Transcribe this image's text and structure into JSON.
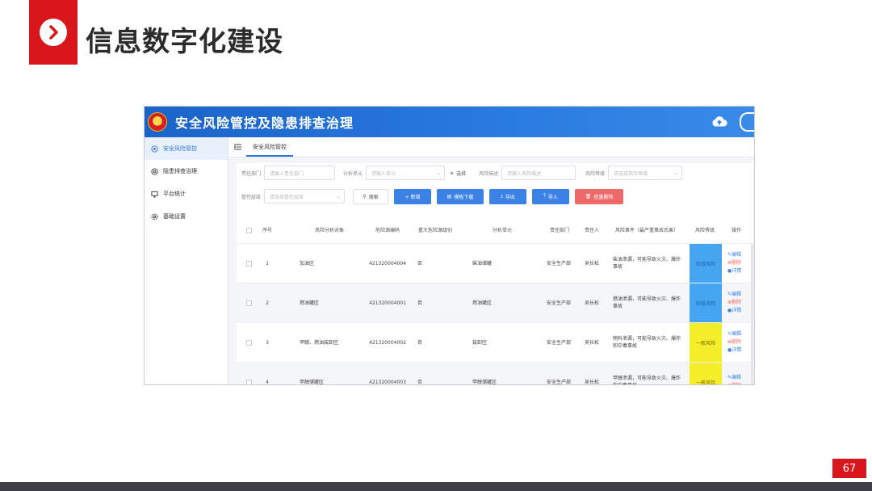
{
  "slide": {
    "title": "信息数字化建设",
    "page_number": "67"
  },
  "app": {
    "title": "安全风险管控及隐患排查治理",
    "sidebar": [
      {
        "label": "安全风险管控",
        "icon": "shield-icon",
        "active": true
      },
      {
        "label": "隐患排查治理",
        "icon": "target-icon",
        "active": false
      },
      {
        "label": "平台统计",
        "icon": "monitor-icon",
        "active": false
      },
      {
        "label": "基础设置",
        "icon": "gear-icon",
        "active": false
      }
    ],
    "tab": "安全风险管控",
    "filters": {
      "dept_label": "责任部门",
      "dept_placeholder": "请输入责任部门",
      "unit_label": "分析单元",
      "unit_placeholder": "请输入单元",
      "select_label": "选择",
      "desc_label": "风险描述",
      "desc_placeholder": "请输入风险描述",
      "level_label": "风险等级",
      "level_placeholder": "请选择风险等级",
      "mgmt_label": "管控层级",
      "mgmt_placeholder": "请选择管控层级"
    },
    "buttons": {
      "search": "搜索",
      "add": "+ 新增",
      "template": "模板下载",
      "export": "导出",
      "import": "导入",
      "batch_delete": "批量删除"
    },
    "columns": [
      "序号",
      "风险分析对象",
      "危险源编码",
      "重大危险源级别",
      "分析单元",
      "责任部门",
      "责任人",
      "风险事件（最严重事故后果）",
      "风险等级",
      "操作"
    ],
    "rows": [
      {
        "no": "1",
        "object": "加油区",
        "code": "421320004004",
        "major": "否",
        "unit": "柴油储罐",
        "dept": "安全生产部",
        "person": "吴长松",
        "event": "柴油泄漏，可能导致火灾、爆炸事故",
        "level": "较低风险",
        "level_type": "low"
      },
      {
        "no": "2",
        "object": "燃油罐区",
        "code": "421320004001",
        "major": "否",
        "unit": "燃油罐区",
        "dept": "安全生产部",
        "person": "吴长松",
        "event": "燃油泄漏，可能导致火灾、爆炸事故",
        "level": "较低风险",
        "level_type": "low"
      },
      {
        "no": "3",
        "object": "甲醇、燃油装卸区",
        "code": "421320004002",
        "major": "否",
        "unit": "装卸区",
        "dept": "安全生产部",
        "person": "吴长松",
        "event": "物料泄漏，可能导致火灾、爆炸和中毒事故",
        "level": "一般风险",
        "level_type": "mid"
      },
      {
        "no": "4",
        "object": "甲醇储罐区",
        "code": "421320004003",
        "major": "否",
        "unit": "甲醇储罐区",
        "dept": "安全生产部",
        "person": "吴长松",
        "event": "甲醇泄漏，可能导致火灾、爆炸和中毒事故",
        "level": "一般风险",
        "level_type": "mid"
      }
    ],
    "ops": {
      "edit": "编辑",
      "delete": "删除",
      "detail": "详情"
    }
  },
  "colors": {
    "accent_red": "#d9161c",
    "header_blue": "#1a63c9",
    "button_blue": "#3b82e6",
    "risk_low": "#46a5f0",
    "risk_mid": "#f4ef2a"
  }
}
